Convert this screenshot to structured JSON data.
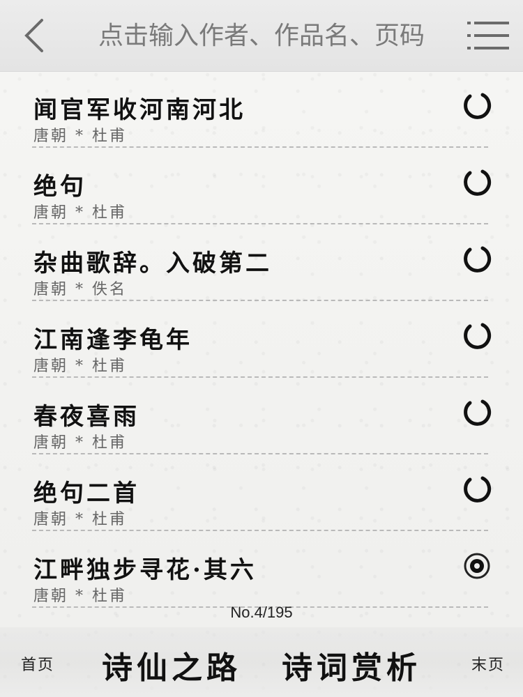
{
  "header": {
    "search_placeholder": "点击输入作者、作品名、页码",
    "back_icon": "chevron-left-icon",
    "menu_icon": "menu-icon"
  },
  "poems": [
    {
      "title": "闻官军收河南河北",
      "meta": "唐朝 * 杜甫",
      "status": "incomplete"
    },
    {
      "title": "绝句",
      "meta": "唐朝 * 杜甫",
      "status": "incomplete"
    },
    {
      "title": "杂曲歌辞。入破第二",
      "meta": "唐朝 * 佚名",
      "status": "incomplete"
    },
    {
      "title": "江南逢李龟年",
      "meta": "唐朝 * 杜甫",
      "status": "incomplete"
    },
    {
      "title": "春夜喜雨",
      "meta": "唐朝 * 杜甫",
      "status": "incomplete"
    },
    {
      "title": "绝句二首",
      "meta": "唐朝 * 杜甫",
      "status": "incomplete"
    },
    {
      "title": "江畔独步寻花·其六",
      "meta": "唐朝 * 杜甫",
      "status": "selected"
    }
  ],
  "page_info": "No.4/195",
  "footer": {
    "first": "首页",
    "road": "诗仙之路",
    "appreciation": "诗词赏析",
    "last": "末页"
  },
  "colors": {
    "ink": "#111111",
    "muted": "#666666",
    "header_bg": "#e6e6e6"
  }
}
